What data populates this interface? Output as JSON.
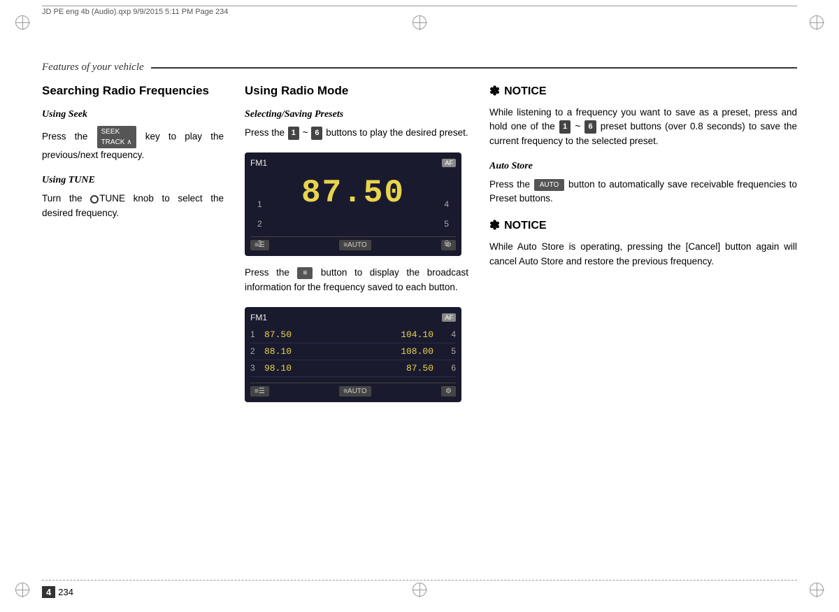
{
  "page": {
    "header_text": "JD PE eng 4b (Audio).qxp  9/9/2015  5:11 PM  Page 234",
    "section_title": "Features of your vehicle",
    "page_number": "4",
    "page_num_suffix": "234"
  },
  "left_col": {
    "heading": "Searching Radio Frequencies",
    "using_seek_label": "Using Seek",
    "using_seek_text_before": "Press the",
    "using_seek_btn": "SEEK TRACK",
    "using_seek_text_after": "key to play the previous/next frequency.",
    "using_tune_label": "Using TUNE",
    "using_tune_text_before": "Turn the",
    "using_tune_text_after": "TUNE knob to select the desired frequency."
  },
  "mid_col": {
    "heading": "Using Radio Mode",
    "selecting_label": "Selecting/Saving Presets",
    "selecting_text_1": "Press the",
    "btn_1": "1",
    "tilde": "~",
    "btn_6": "6",
    "selecting_text_2": "buttons to play the desired preset.",
    "screen1": {
      "label": "FM1",
      "af": "AF",
      "freq": "87.50",
      "left_nums": [
        "1",
        "2",
        "3"
      ],
      "right_nums": [
        "4",
        "5",
        "6"
      ]
    },
    "press_info_1": "Press the",
    "info_btn_label": "≡",
    "press_info_2": "button to display the broadcast information for the frequency saved to each button.",
    "screen2": {
      "label": "FM1",
      "af": "AF",
      "presets": [
        {
          "num": "1",
          "freq_left": "87.50",
          "freq_right": "104.10",
          "num_right": "4"
        },
        {
          "num": "2",
          "freq_left": "88.10",
          "freq_right": "108.00",
          "num_right": "5"
        },
        {
          "num": "3",
          "freq_left": "98.10",
          "freq_right": "87.50",
          "num_right": "6"
        }
      ]
    }
  },
  "right_col": {
    "notice1_star": "✽",
    "notice1_heading": "NOTICE",
    "notice1_text_1": "While listening to a frequency you want to save as a preset, press and hold one of the",
    "notice1_btn1": "1",
    "notice1_tilde": "~",
    "notice1_btn6": "6",
    "notice1_text_2": "preset buttons (over 0.8 seconds) to save the current frequency to the selected preset.",
    "auto_store_label": "Auto Store",
    "auto_store_text_1": "Press the",
    "auto_store_btn_label": "AUTO",
    "auto_store_text_2": "button to automatically save receivable frequencies to Preset buttons.",
    "notice2_star": "✽",
    "notice2_heading": "NOTICE",
    "notice2_text": "While Auto Store is operating, pressing the [Cancel] button again will cancel Auto Store and restore the previous frequency."
  }
}
